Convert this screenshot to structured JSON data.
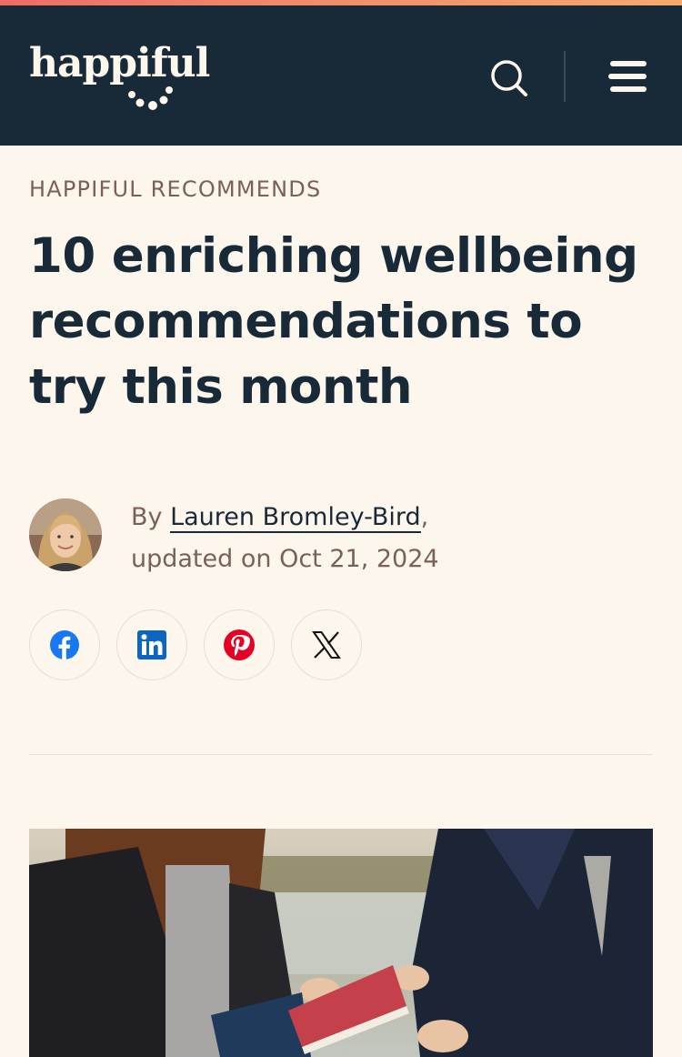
{
  "brand": {
    "logo_text": "happiful",
    "accent_gradient": [
      "#ee6d63",
      "#f6a96e"
    ],
    "header_bg": "#182a38",
    "page_bg": "#fdf6ec"
  },
  "header": {
    "search_icon": "search-icon",
    "menu_icon": "hamburger-menu-icon"
  },
  "article": {
    "category": "HAPPIFUL RECOMMENDS",
    "title": "10 enriching wellbeing recommendations to try this month",
    "byline_prefix": "By ",
    "author": "Lauren Bromley-Bird",
    "byline_sep": ",",
    "updated": "updated on Oct 21, 2024"
  },
  "share": {
    "facebook_icon": "facebook-icon",
    "linkedin_icon": "linkedin-icon",
    "pinterest_icon": "pinterest-icon",
    "x_icon": "x-icon"
  },
  "hero_image": "two-people-exchanging-books-outdoors-photo"
}
